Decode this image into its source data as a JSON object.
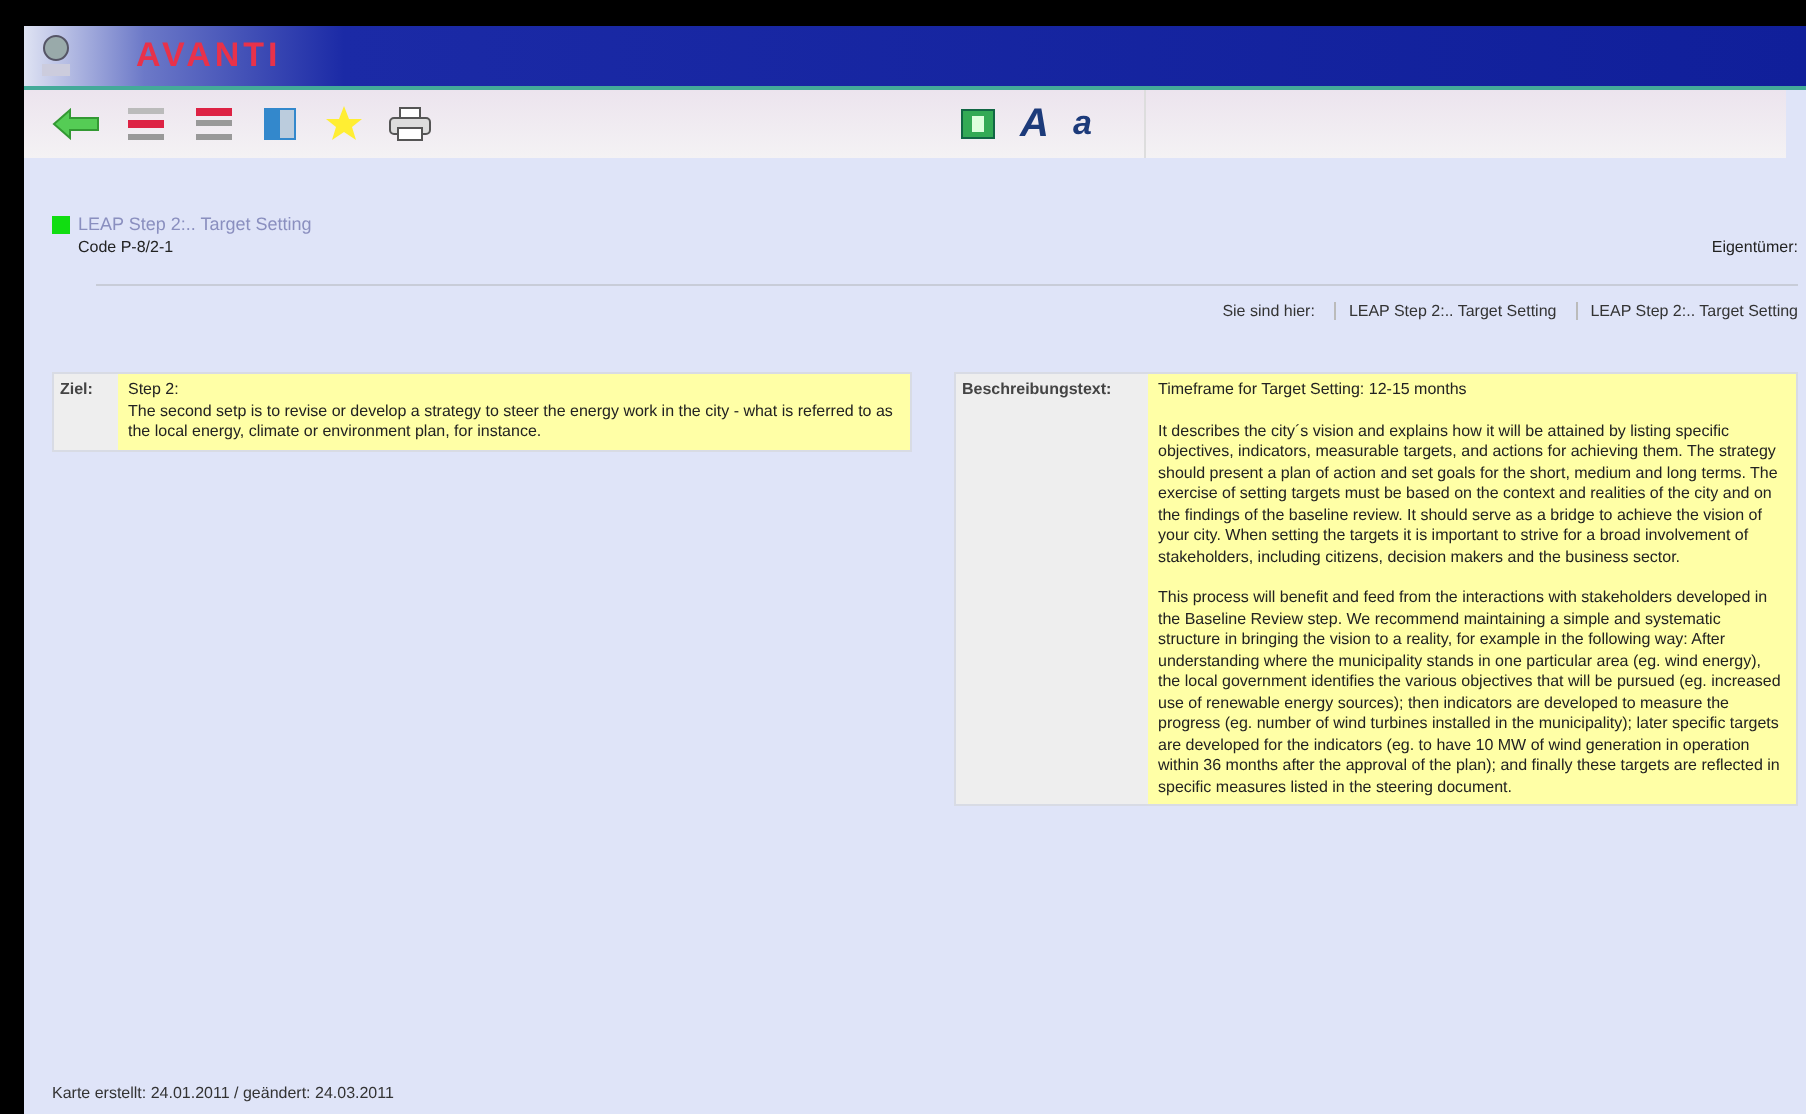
{
  "header": {
    "logo_text": "AVANTI"
  },
  "toolbar": {
    "font_buttons": [
      "A",
      "a"
    ]
  },
  "card": {
    "title": "LEAP Step 2:.. Target Setting",
    "code": "Code P-8/2-1",
    "owner_label": "Eigentümer:"
  },
  "breadcrumb": {
    "label": "Sie sind hier:",
    "items": [
      "LEAP Step 2:.. Target Setting",
      "LEAP Step 2:.. Target Setting"
    ]
  },
  "goal": {
    "label": "Ziel:",
    "heading": "Step 2:",
    "text": "The second setp is to revise or develop a strategy to steer the energy work in the city - what is referred to as the local energy, climate or environment plan, for instance."
  },
  "description": {
    "label": "Beschreibungstext:",
    "paragraphs": [
      "Timeframe for Target Setting: 12-15 months",
      "It describes the city´s vision and explains how it will be attained by listing specific objectives, indicators, measurable targets, and actions for achieving them. The strategy should present a plan of action and set goals for the short, medium and long terms. The exercise of setting targets must be based on the context and realities of the city and on the findings of the baseline review. It should serve as a bridge to achieve the vision of your city. When setting the targets it is important to strive for a broad involvement of stakeholders, including citizens, decision makers and the business sector.",
      "This process will benefit and feed from the interactions with stakeholders developed in the Baseline Review step. We recommend maintaining a simple and systematic structure in bringing the vision to a reality, for example in the following way: After understanding where the municipality stands in one particular area (eg. wind energy), the local government identifies the various objectives that will be pursued (eg. increased use of renewable energy sources); then indicators are developed to measure the progress (eg. number of wind turbines installed in the municipality); later specific targets are developed for the indicators (eg. to have 10 MW of wind generation in operation within 36 months after the approval of the plan); and finally these targets are reflected in specific measures listed in the steering document."
    ]
  },
  "footer": {
    "text": "Karte erstellt: 24.01.2011 / geändert: 24.03.2011"
  }
}
